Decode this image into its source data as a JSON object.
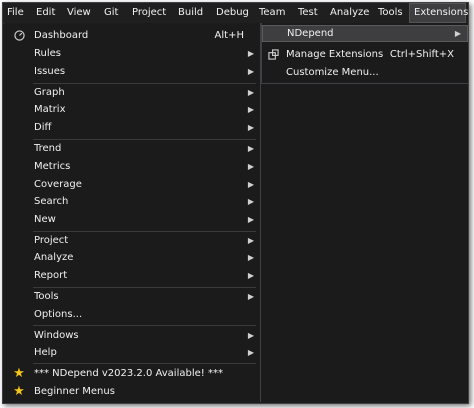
{
  "menubar": [
    {
      "label": "File"
    },
    {
      "label": "Edit"
    },
    {
      "label": "View"
    },
    {
      "label": "Git"
    },
    {
      "label": "Project"
    },
    {
      "label": "Build"
    },
    {
      "label": "Debug"
    },
    {
      "label": "Team"
    },
    {
      "label": "Test"
    },
    {
      "label": "Analyze"
    },
    {
      "label": "Tools"
    },
    {
      "label": "Extensions"
    }
  ],
  "left_menu": {
    "dashboard": {
      "label": "Dashboard",
      "shortcut": "Alt+H",
      "icon": "gauge-icon"
    },
    "rules": {
      "label": "Rules"
    },
    "issues": {
      "label": "Issues"
    },
    "graph": {
      "label": "Graph"
    },
    "matrix": {
      "label": "Matrix"
    },
    "diff": {
      "label": "Diff"
    },
    "trend": {
      "label": "Trend"
    },
    "metrics": {
      "label": "Metrics"
    },
    "coverage": {
      "label": "Coverage"
    },
    "search": {
      "label": "Search"
    },
    "new": {
      "label": "New"
    },
    "project": {
      "label": "Project"
    },
    "analyze": {
      "label": "Analyze"
    },
    "report": {
      "label": "Report"
    },
    "tools": {
      "label": "Tools"
    },
    "options": {
      "label": "Options..."
    },
    "windows": {
      "label": "Windows"
    },
    "help": {
      "label": "Help"
    },
    "update": {
      "label": "*** NDepend v2023.2.0 Available! ***",
      "icon": "star-icon"
    },
    "beginner": {
      "label": "Beginner Menus",
      "icon": "star-icon"
    }
  },
  "right_menu": {
    "ndepend": {
      "label": "NDepend"
    },
    "manage": {
      "label": "Manage Extensions",
      "shortcut": "Ctrl+Shift+X",
      "icon": "extensions-icon"
    },
    "customize": {
      "label": "Customize Menu..."
    }
  },
  "colors": {
    "background": "#1b1b1c",
    "highlight": "#3e3e40",
    "star": "#f5c518"
  }
}
